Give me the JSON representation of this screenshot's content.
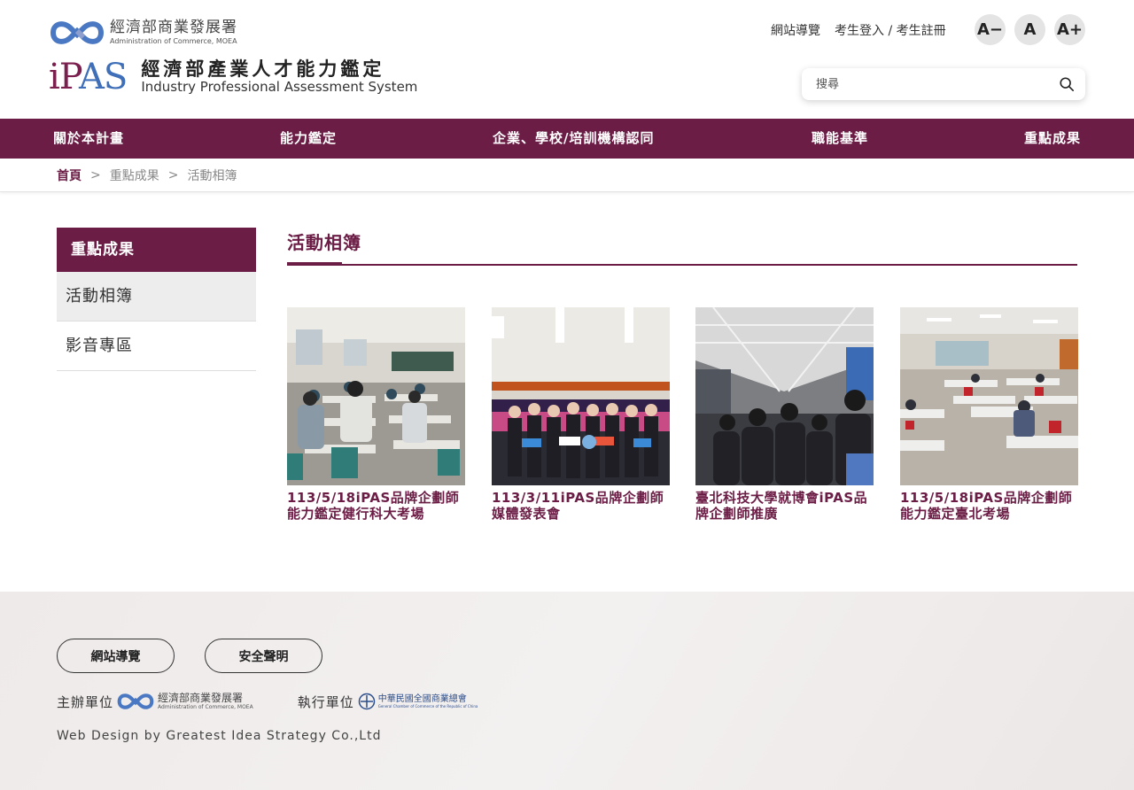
{
  "header": {
    "moea_logo": {
      "zh": "經濟部商業發展署",
      "en": "Administration of Commerce, MOEA",
      "icon": "moea-infinity-logo"
    },
    "ipas_logo": {
      "mark_a": "iP",
      "mark_b": "AS",
      "zh": "經濟部產業人才能力鑑定",
      "en": "Industry Professional Assessment System"
    },
    "top_links": {
      "sitemap": "網站導覽",
      "login": "考生登入 / 考生註冊"
    },
    "font_buttons": {
      "smaller": "A−",
      "normal": "A",
      "larger": "A+"
    },
    "search": {
      "placeholder": "搜尋",
      "value": "",
      "icon": "search-icon"
    }
  },
  "nav": {
    "items": [
      "關於本計畫",
      "能力鑑定",
      "企業、學校/培訓機構認同",
      "職能基準",
      "重點成果"
    ]
  },
  "breadcrumb": {
    "home": "首頁",
    "sep": ">",
    "level1": "重點成果",
    "level2": "活動相簿"
  },
  "sidebar": {
    "title": "重點成果",
    "items": [
      {
        "label": "活動相簿",
        "active": true
      },
      {
        "label": "影音專區",
        "active": false
      }
    ]
  },
  "main": {
    "title": "活動相簿",
    "albums": [
      {
        "title": "113/5/18iPAS品牌企劃師能力鑑定健行科大考場"
      },
      {
        "title": "113/3/11iPAS品牌企劃師媒體發表會"
      },
      {
        "title": "臺北科技大學就博會iPAS品牌企劃師推廣"
      },
      {
        "title": "113/5/18iPAS品牌企劃師能力鑑定臺北考場"
      }
    ]
  },
  "footer": {
    "buttons": {
      "sitemap": "網站導覽",
      "security": "安全聲明"
    },
    "organizer_label": "主辦單位",
    "organizer": {
      "zh": "經濟部商業發展署",
      "en": "Administration of Commerce, MOEA"
    },
    "executor_label": "執行單位",
    "executor": {
      "zh": "中華民國全國商業總會",
      "en": "General Chamber of Commerce of the Republic of China"
    },
    "credit": "Web Design by  Greatest Idea Strategy Co.,Ltd"
  },
  "colors": {
    "brand": "#6b1d45",
    "accent_blue": "#3e6fb8"
  }
}
